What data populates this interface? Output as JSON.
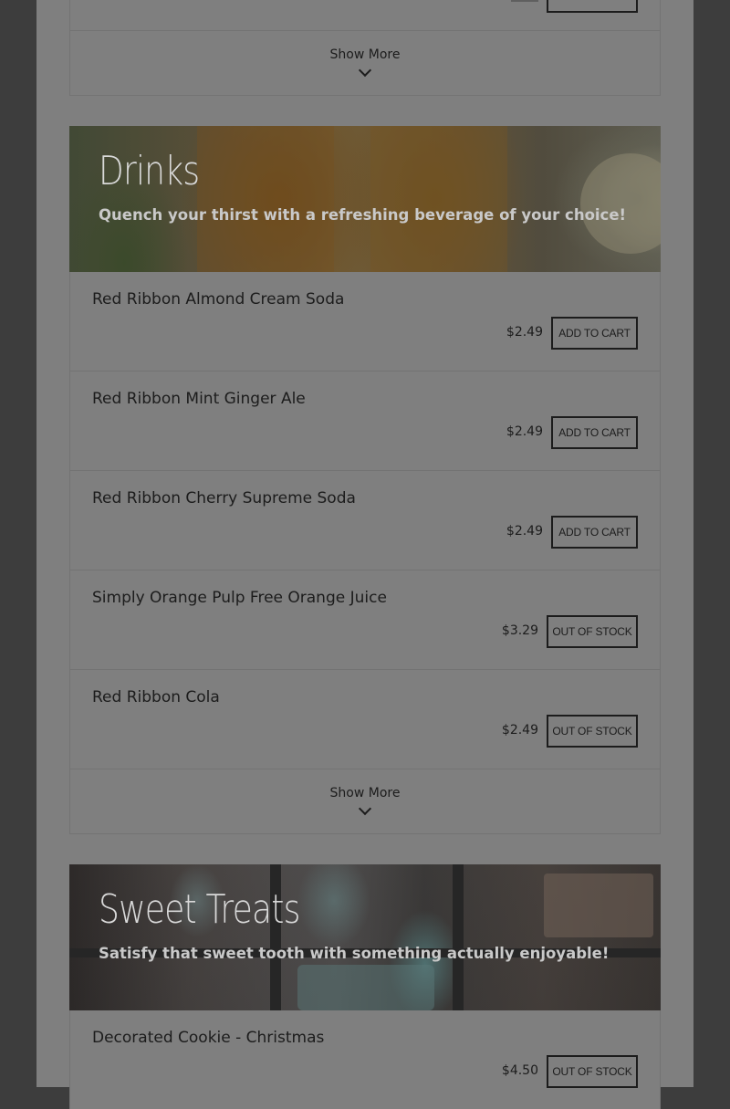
{
  "top_section": {
    "show_more_label": "Show More"
  },
  "drinks": {
    "title": "Drinks",
    "subtitle": "Quench your thirst with a refreshing beverage of your choice!",
    "items": [
      {
        "name": "Red Ribbon Almond Cream Soda",
        "price": "$2.49",
        "button": "Add to cart"
      },
      {
        "name": "Red Ribbon Mint Ginger Ale",
        "price": "$2.49",
        "button": "Add to cart"
      },
      {
        "name": "Red Ribbon Cherry Supreme Soda",
        "price": "$2.49",
        "button": "Add to cart"
      },
      {
        "name": "Simply Orange Pulp Free Orange Juice",
        "price": "$3.29",
        "button": "Out of stock"
      },
      {
        "name": "Red Ribbon Cola",
        "price": "$2.49",
        "button": "Out of stock"
      }
    ],
    "show_more_label": "Show More"
  },
  "sweet_treats": {
    "title": "Sweet Treats",
    "subtitle": "Satisfy that sweet tooth with something actually enjoyable!",
    "items": [
      {
        "name": "Decorated Cookie - Christmas",
        "price": "$4.50",
        "button": "Out of stock"
      }
    ]
  },
  "colors": {
    "overlay_page": "#7f7f7f",
    "overlay_backdrop": "#3d3d3d",
    "text": "#1c1c1c"
  }
}
